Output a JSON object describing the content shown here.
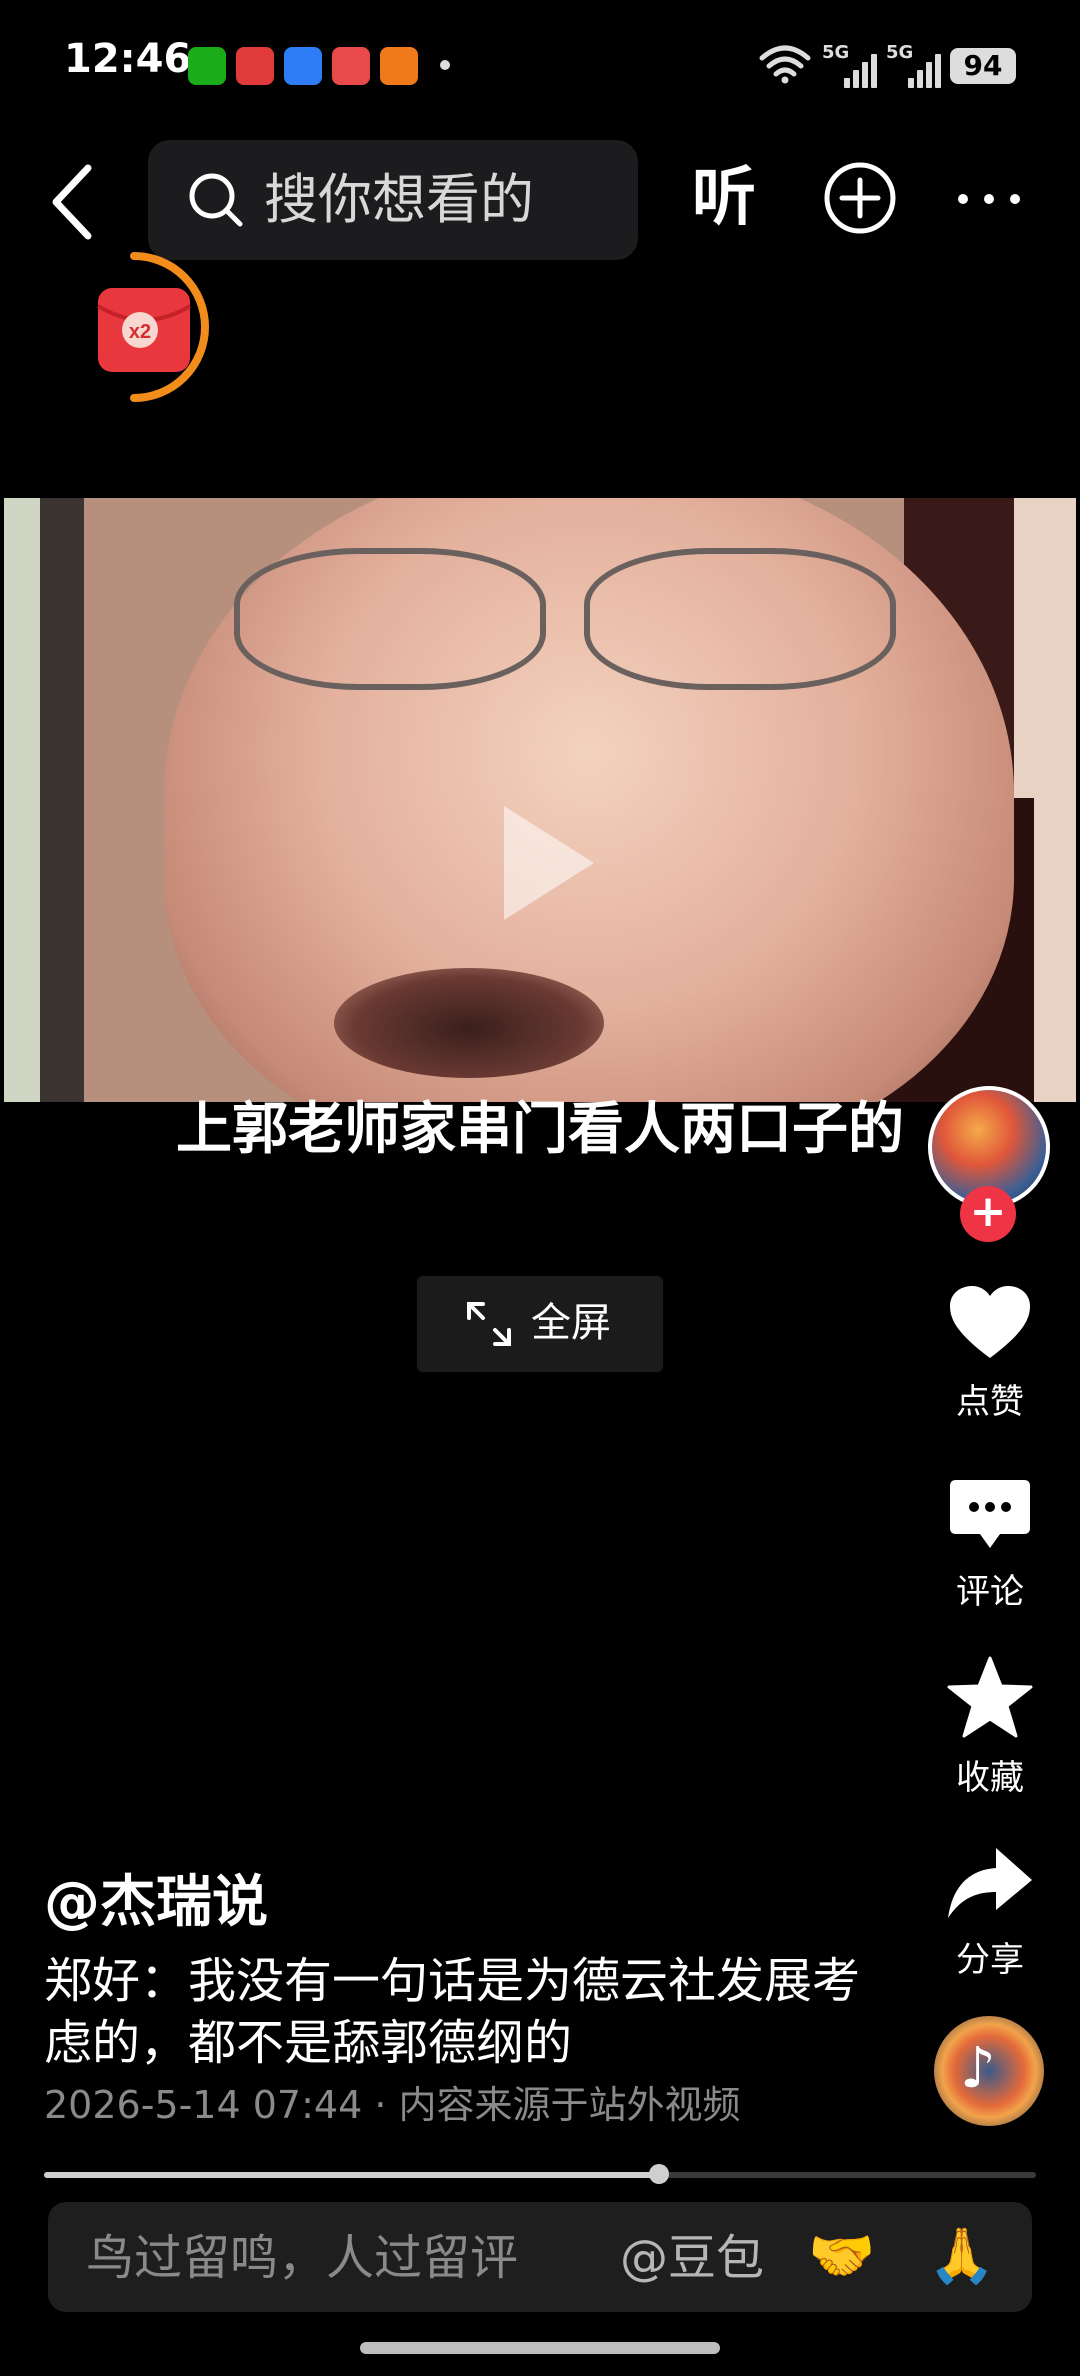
{
  "status_bar": {
    "time": "12:46",
    "network_1": "5G",
    "network_2": "5G",
    "battery": "94",
    "app_icons": [
      "wechat-icon",
      "toutiao-icon",
      "browser-icon",
      "video-app-icon",
      "shopping-app-icon"
    ]
  },
  "top_nav": {
    "search_placeholder": "搜你想看的",
    "listen_label": "听"
  },
  "red_packet": {
    "multiplier": "x2",
    "accent": "#f28c1b"
  },
  "video": {
    "caption": "上郭老师家串门看人两口子的",
    "fullscreen_label": "全屏"
  },
  "actions": {
    "like_label": "点赞",
    "comment_label": "评论",
    "favorite_label": "收藏",
    "share_label": "分享",
    "follow_symbol": "+",
    "follow_color": "#ef3446"
  },
  "post": {
    "author": "@杰瑞说",
    "description": "郑好：我没有一句话是为德云社发展考虑的，都不是舔郭德纲的",
    "meta": "2026-5-14 07:44 · 内容来源于站外视频"
  },
  "playback": {
    "progress_fraction": 0.62
  },
  "comment_bar": {
    "placeholder": "鸟过留鸣，人过留评",
    "mention": "@豆包",
    "emoji_1": "🤝",
    "emoji_2": "🙏"
  }
}
